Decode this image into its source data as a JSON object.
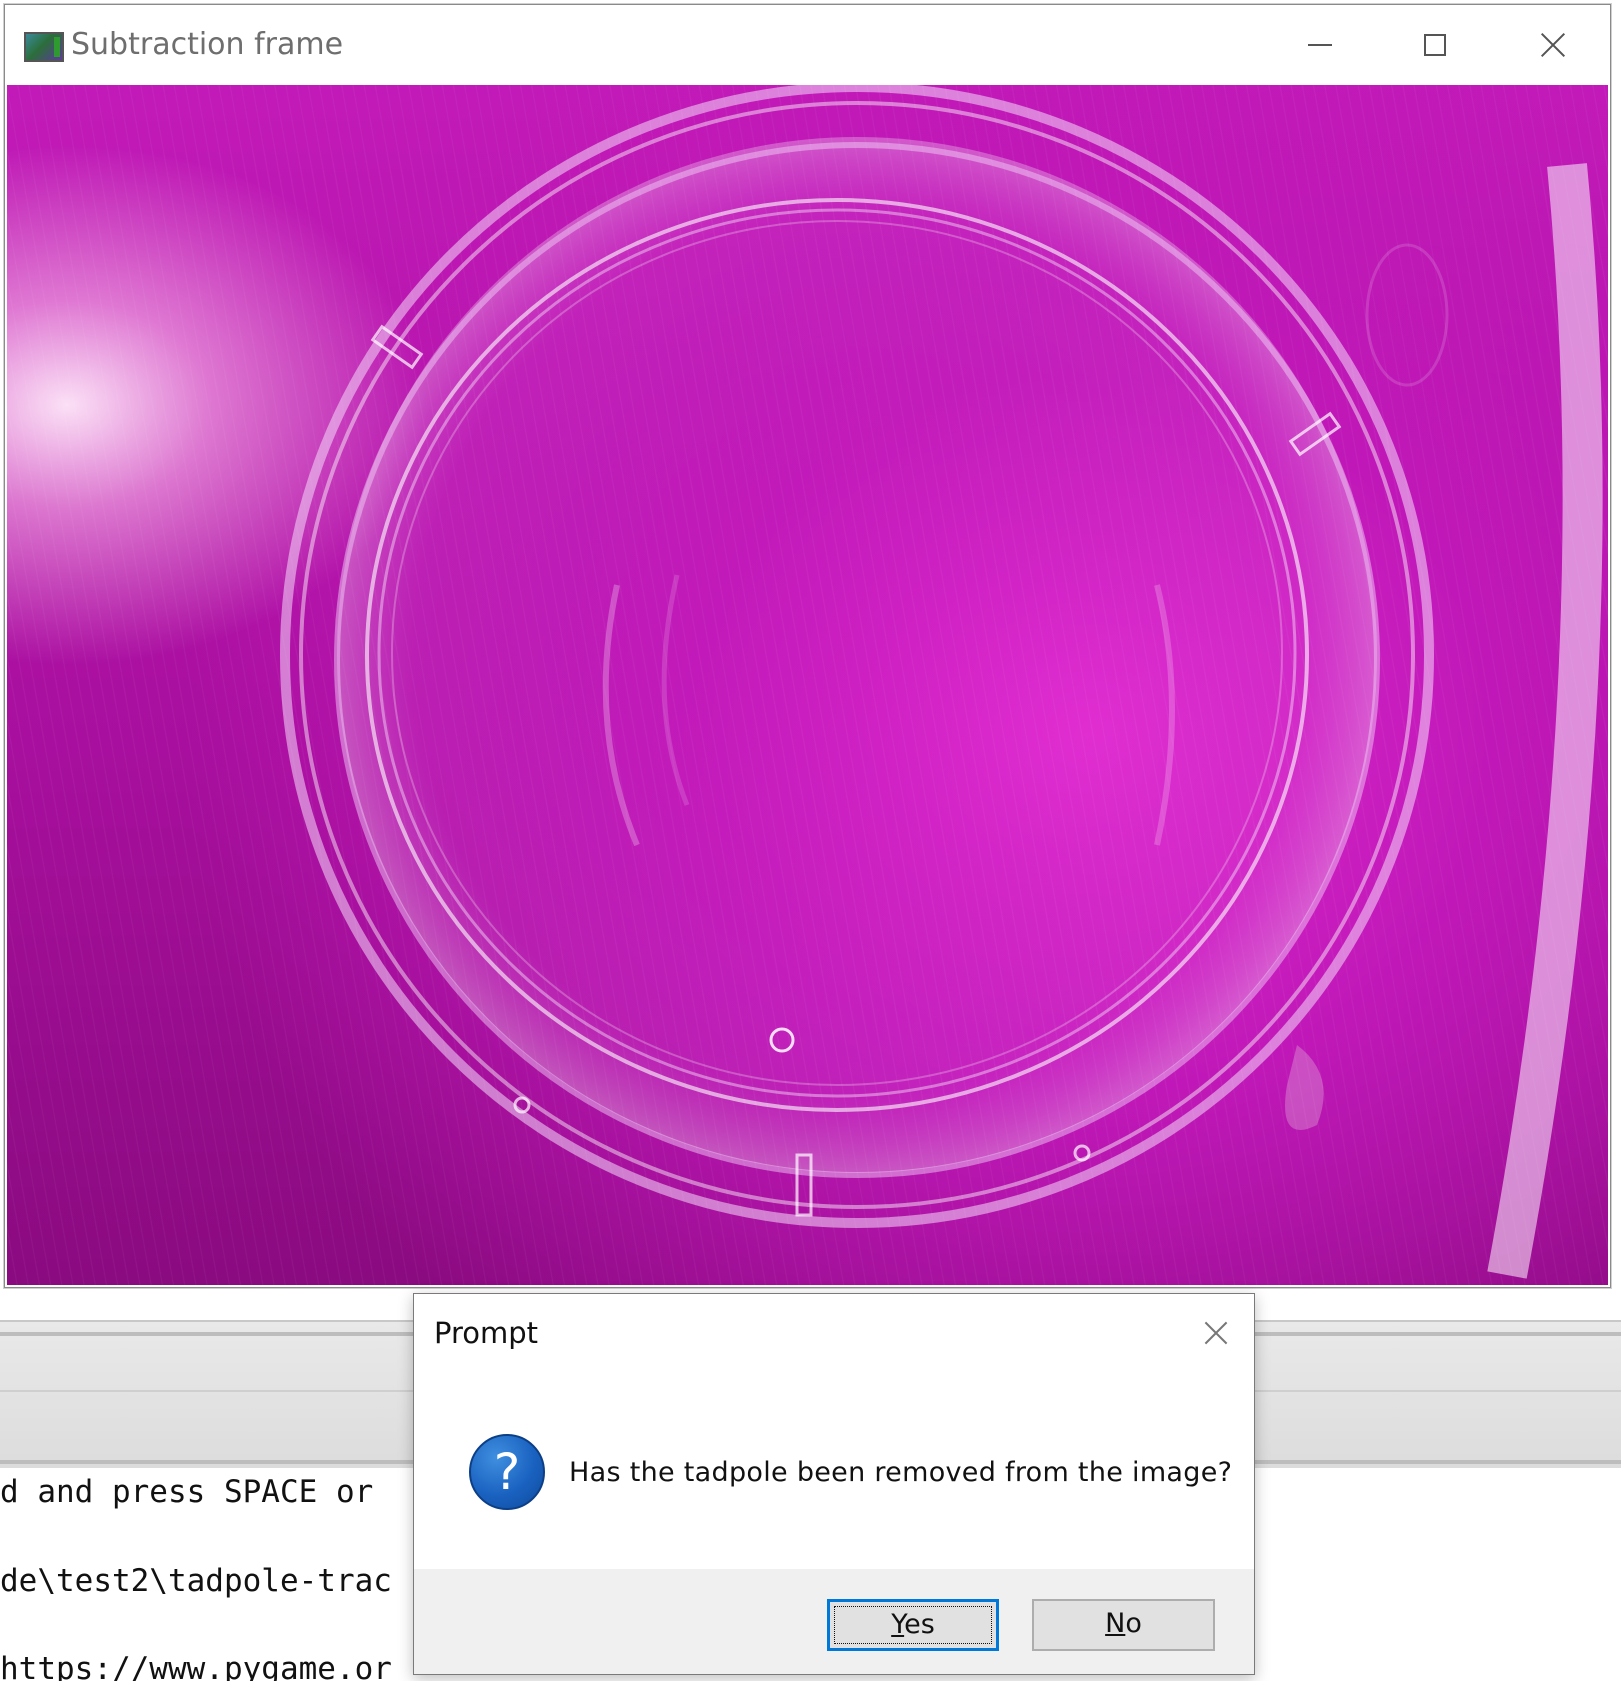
{
  "window": {
    "title": "Subtraction frame",
    "controls": [
      "minimize",
      "maximize",
      "close"
    ]
  },
  "background_console": {
    "lines": [
      "d and press SPACE or",
      "de\\test2\\tadpole-trac",
      "https://www.pygame.or"
    ]
  },
  "dialog": {
    "title": "Prompt",
    "icon": "question-icon",
    "message": "Has the tadpole been removed from the image?",
    "buttons": {
      "yes_mnemonic": "Y",
      "yes_rest": "es",
      "no_mnemonic": "N",
      "no_rest": "o"
    },
    "default_button": "Yes"
  },
  "colors": {
    "accent": "#0078d7",
    "image_magenta": "#c21ab8",
    "question_blue": "#1a62c0"
  }
}
